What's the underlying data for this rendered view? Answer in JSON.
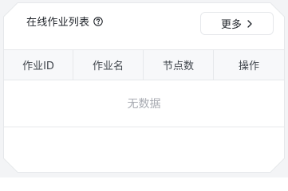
{
  "panel": {
    "title": "在线作业列表",
    "help_icon": "question-circle-icon",
    "more_label": "更多",
    "more_icon": "chevron-right-icon"
  },
  "table": {
    "columns": [
      "作业ID",
      "作业名",
      "节点数",
      "操作"
    ],
    "rows": [],
    "empty_text": "无数据"
  },
  "colors": {
    "border": "#e6e8eb",
    "header_bg": "#f7f8fa",
    "text": "#1f2329",
    "muted": "#a8abb2"
  }
}
